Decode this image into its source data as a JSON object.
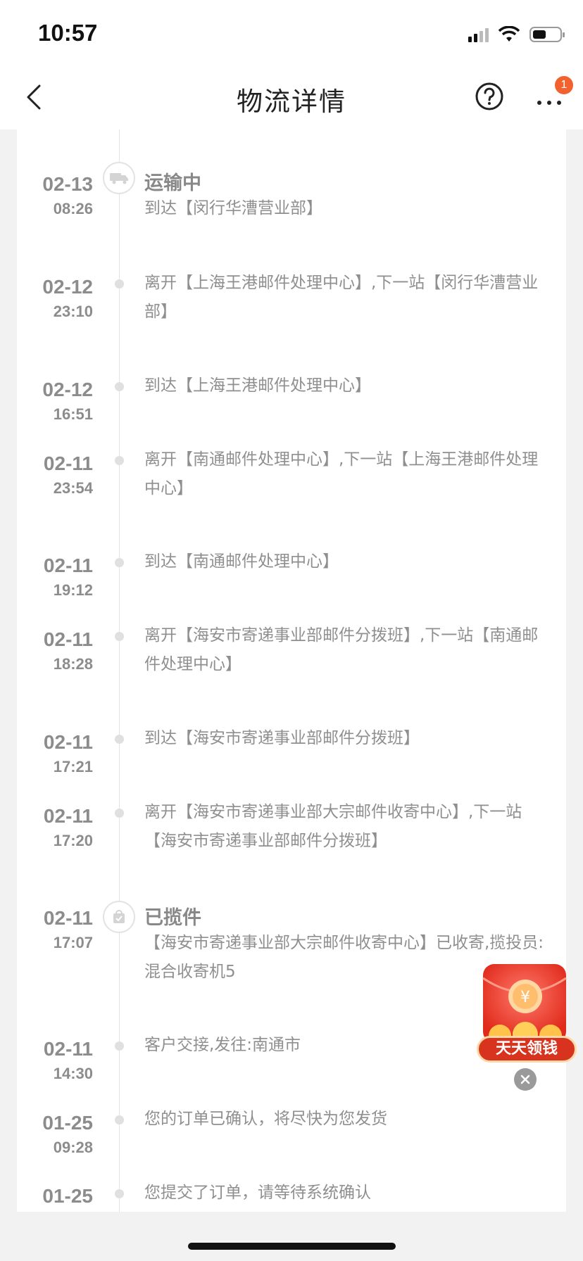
{
  "status_bar": {
    "time": "10:57"
  },
  "nav": {
    "title": "物流详情",
    "badge_count": "1"
  },
  "events": [
    {
      "date": "02-13",
      "time": "08:26",
      "title": "运输中",
      "text": "到达【闵行华漕营业部】",
      "icon": "truck-icon"
    },
    {
      "date": "02-12",
      "time": "23:10",
      "text": "离开【上海王港邮件处理中心】,下一站【闵行华漕营业部】"
    },
    {
      "date": "02-12",
      "time": "16:51",
      "text": "到达【上海王港邮件处理中心】"
    },
    {
      "date": "02-11",
      "time": "23:54",
      "text": "离开【南通邮件处理中心】,下一站【上海王港邮件处理中心】"
    },
    {
      "date": "02-11",
      "time": "19:12",
      "text": "到达【南通邮件处理中心】"
    },
    {
      "date": "02-11",
      "time": "18:28",
      "text": "离开【海安市寄递事业部邮件分拨班】,下一站【南通邮件处理中心】"
    },
    {
      "date": "02-11",
      "time": "17:21",
      "text": "到达【海安市寄递事业部邮件分拨班】"
    },
    {
      "date": "02-11",
      "time": "17:20",
      "text": "离开【海安市寄递事业部大宗邮件收寄中心】,下一站【海安市寄递事业部邮件分拨班】"
    },
    {
      "date": "02-11",
      "time": "17:07",
      "title": "已揽件",
      "text": "【海安市寄递事业部大宗邮件收寄中心】已收寄,揽投员:混合收寄机5",
      "icon": "parcel-icon"
    },
    {
      "date": "02-11",
      "time": "14:30",
      "text": "客户交接,发往:南通市"
    },
    {
      "date": "01-25",
      "time": "09:28",
      "text": "您的订单已确认，将尽快为您发货"
    },
    {
      "date": "01-25",
      "time": "",
      "text": "您提交了订单，请等待系统确认"
    }
  ],
  "promo": {
    "label": "天天领钱",
    "currency_symbol": "¥"
  }
}
